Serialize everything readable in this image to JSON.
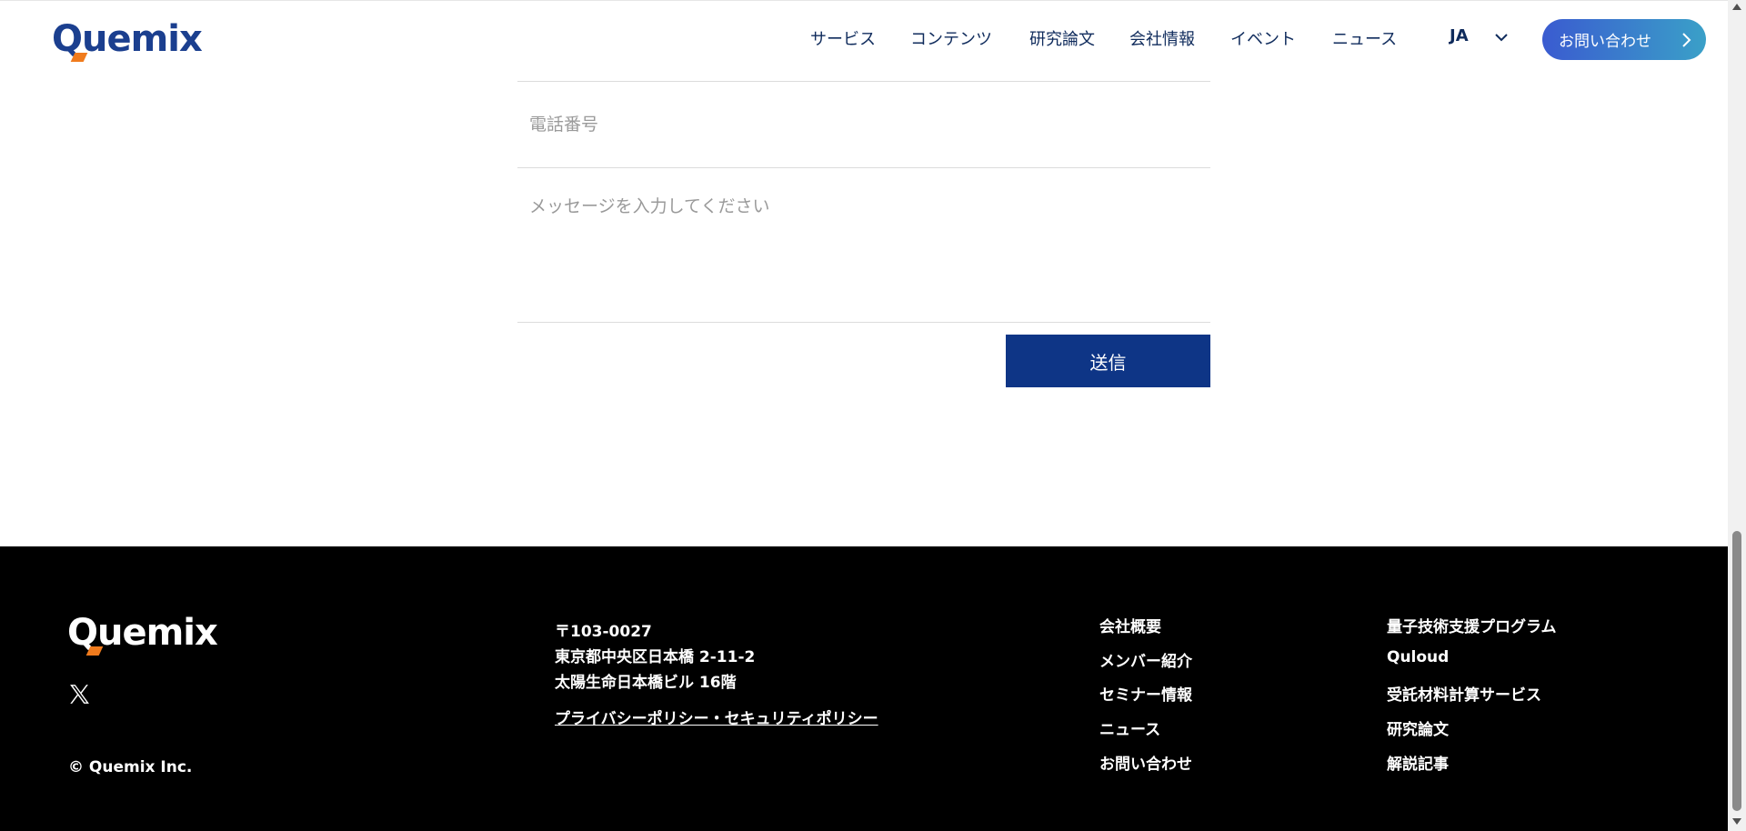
{
  "header": {
    "logo_text": "Quemix",
    "nav": [
      {
        "label": "サービス"
      },
      {
        "label": "コンテンツ"
      },
      {
        "label": "研究論文"
      },
      {
        "label": "会社情報"
      },
      {
        "label": "イベント"
      },
      {
        "label": "ニュース"
      }
    ],
    "lang_label": "JA",
    "contact_label": "お問い合わせ"
  },
  "form": {
    "phone_placeholder": "電話番号",
    "phone_value": "",
    "message_placeholder": "メッセージを入力してください",
    "message_value": "",
    "submit_label": "送信"
  },
  "footer": {
    "logo_text": "Quemix",
    "address": [
      "〒103-0027",
      "東京都中央区日本橋 2-11-2",
      "太陽生命日本橋ビル 16階"
    ],
    "policy_link": "プライバシーポリシー・セキュリティポリシー",
    "copyright": "© Quemix Inc.",
    "links_col1": [
      "会社概要",
      "メンバー紹介",
      "セミナー情報",
      "ニュース",
      "お問い合わせ"
    ],
    "links_col2": [
      "量子技術支援プログラム",
      "Quloud",
      "受託材料計算サービス",
      "研究論文",
      "解説記事"
    ]
  },
  "colors": {
    "brand_navy": "#1b3f8f",
    "brand_orange": "#f07b1d",
    "submit_bg": "#0e3586",
    "footer_bg": "#000000"
  },
  "icons": {
    "social": "x-icon",
    "lang_toggle": "chevron-down-icon",
    "contact_arrow": "chevron-right-icon"
  }
}
